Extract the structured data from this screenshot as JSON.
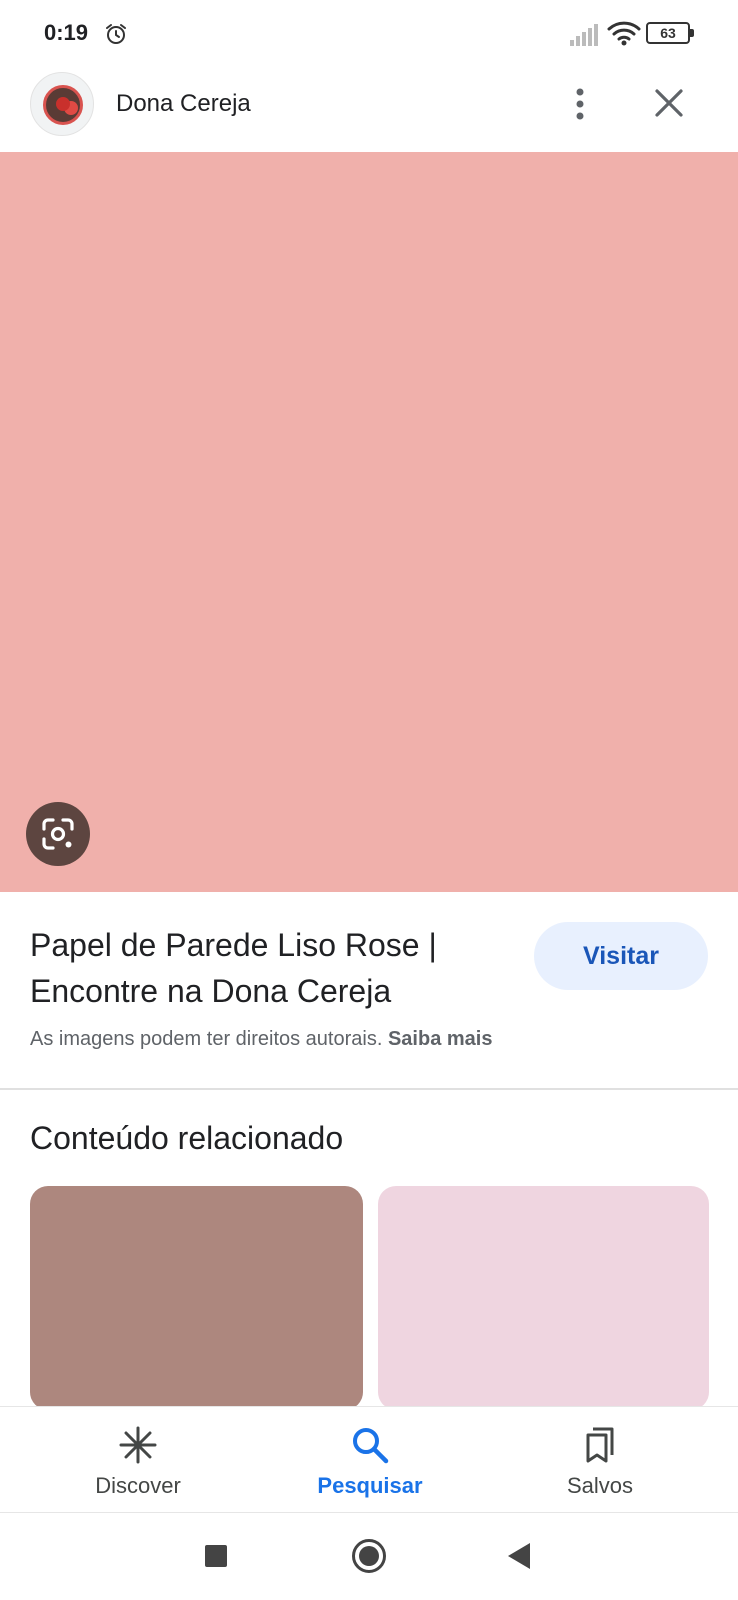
{
  "status_bar": {
    "time": "0:19",
    "battery": "63",
    "icons": [
      "alarm-icon",
      "signal-icon",
      "wifi-icon",
      "battery-icon"
    ]
  },
  "header": {
    "site_name": "Dona Cereja",
    "avatar_icon": "dona-cereja-logo",
    "more_icon": "more-vert-icon",
    "close_icon": "close-icon"
  },
  "hero": {
    "color": "#f0b0ab",
    "lens_icon": "google-lens-icon"
  },
  "info": {
    "title": "Papel de Parede Liso Rose | Encontre na Dona Cereja",
    "visit_label": "Visitar",
    "copyright_text": "As imagens podem ter direitos autorais.",
    "learn_more": "Saiba mais"
  },
  "related": {
    "title": "Conteúdo relacionado",
    "cards": [
      {
        "color": "#ad877e"
      },
      {
        "color": "#efd5e0"
      }
    ]
  },
  "bottom_nav": {
    "items": [
      {
        "label": "Discover",
        "icon": "asterisk-icon",
        "active": false
      },
      {
        "label": "Pesquisar",
        "icon": "search-icon",
        "active": true
      },
      {
        "label": "Salvos",
        "icon": "bookmarks-icon",
        "active": false
      }
    ],
    "active_color": "#1a73e8"
  }
}
